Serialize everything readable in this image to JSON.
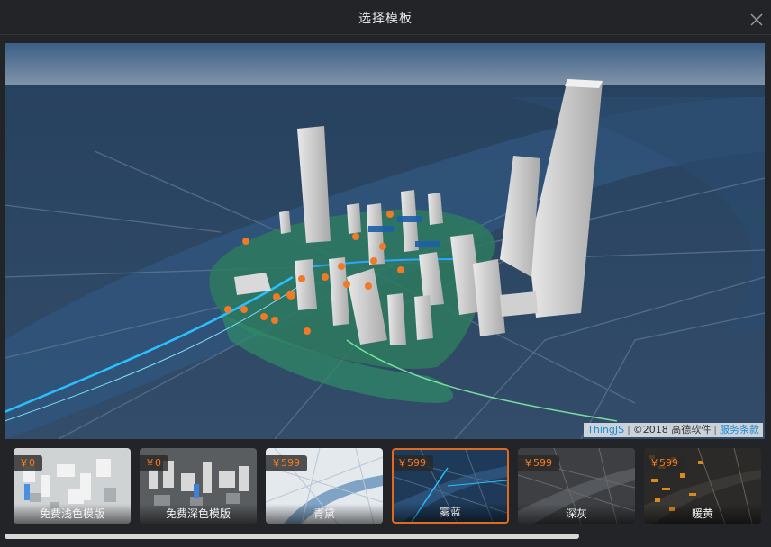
{
  "dialog": {
    "title": "选择模板",
    "close_icon": "close-icon"
  },
  "preview": {
    "attribution": {
      "brand": "ThingJS",
      "copyright": "©2018 高德软件",
      "terms": "服务条款"
    }
  },
  "templates": [
    {
      "price": "￥0",
      "label": "免费浅色模版",
      "selected": false
    },
    {
      "price": "￥0",
      "label": "免费深色模版",
      "selected": false
    },
    {
      "price": "￥599",
      "label": "青黛",
      "selected": false
    },
    {
      "price": "￥599",
      "label": "雾蓝",
      "selected": true
    },
    {
      "price": "￥599",
      "label": "深灰",
      "selected": false
    },
    {
      "price": "￥599",
      "label": "暖黄",
      "selected": false
    }
  ],
  "colors": {
    "accent": "#e06a1d",
    "price": "#ff7a1a",
    "link": "#1a8bd6"
  }
}
